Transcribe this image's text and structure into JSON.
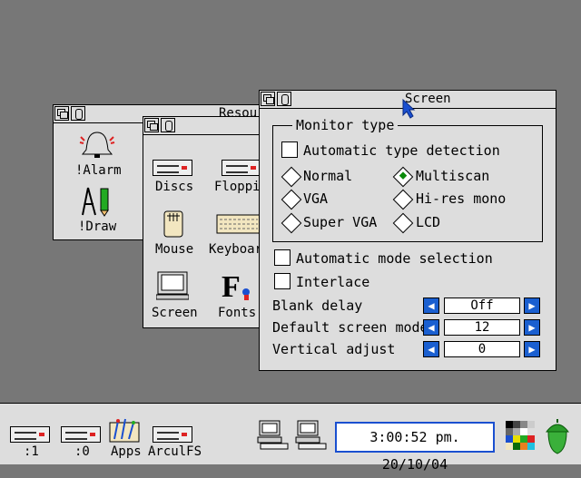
{
  "resources_window": {
    "title": "Resou",
    "items": [
      "!Alarm",
      "!Draw"
    ]
  },
  "apps_window": {
    "items": [
      "Discs",
      "Floppie",
      "Mouse",
      "Keyboar",
      "Screen",
      "Fonts"
    ]
  },
  "screen_window": {
    "title": "Screen",
    "monitor_type_group": "Monitor type",
    "auto_type_detection": "Automatic type detection",
    "options": {
      "normal": "Normal",
      "multiscan": "Multiscan",
      "vga": "VGA",
      "hires_mono": "Hi-res mono",
      "super_vga": "Super VGA",
      "lcd": "LCD"
    },
    "selected_option": "Multiscan",
    "auto_mode_selection": "Automatic mode selection",
    "interlace": "Interlace",
    "blank_delay": {
      "label": "Blank delay",
      "value": "Off"
    },
    "default_screen_mode": {
      "label": "Default screen mode",
      "value": "12"
    },
    "vertical_adjust": {
      "label": "Vertical adjust",
      "value": "0"
    }
  },
  "iconbar": {
    "drive1": ":1",
    "drive0": ":0",
    "apps": "Apps",
    "arculfs": "ArculFS",
    "clock": "3:00:52 pm. 20/10/04"
  },
  "colors": {
    "desktop": "#777777",
    "window": "#dddddd",
    "arrow_button": "#1a5fd0",
    "radio_selected": "#0a8a0a",
    "pointer": "#1a4fd0"
  }
}
